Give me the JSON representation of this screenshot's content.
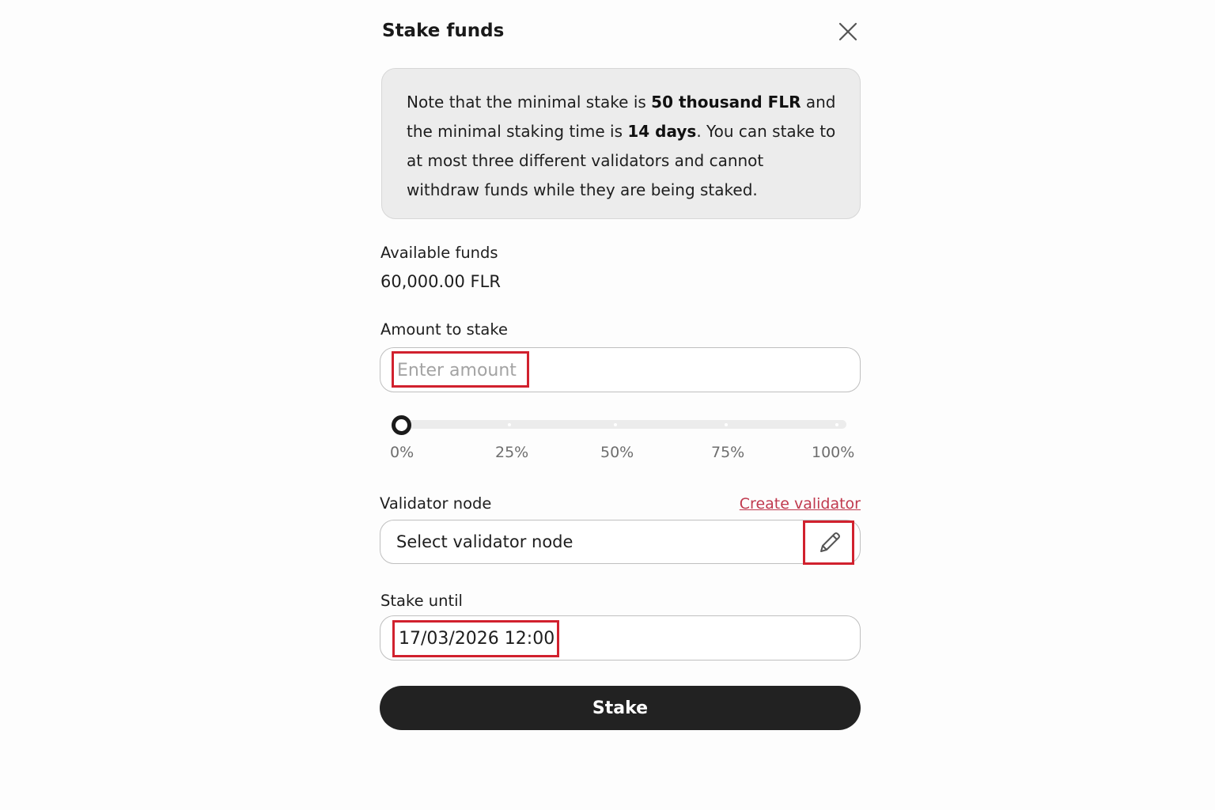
{
  "modal": {
    "title": "Stake funds",
    "close_icon": "close-icon"
  },
  "note": {
    "part1": "Note that the minimal stake is ",
    "bold1": "50 thousand FLR",
    "part2": " and the minimal staking time is ",
    "bold2": "14 days",
    "part3": ". You can stake to at most three different validators and cannot withdraw funds while they are being staked."
  },
  "available_funds": {
    "label": "Available funds",
    "value": "60,000.00 FLR"
  },
  "amount": {
    "label": "Amount to stake",
    "placeholder": "Enter amount",
    "value": ""
  },
  "slider": {
    "value_percent": 0,
    "ticks": [
      "0%",
      "25%",
      "50%",
      "75%",
      "100%"
    ]
  },
  "validator": {
    "label": "Validator node",
    "create_link": "Create validator",
    "select_text": "Select validator node",
    "edit_icon": "pencil-icon"
  },
  "stake_until": {
    "label": "Stake until",
    "value": "17/03/2026 12:00"
  },
  "actions": {
    "stake_label": "Stake"
  },
  "colors": {
    "highlight": "#d1212e",
    "link": "#c0394e",
    "primary_button": "#222222"
  }
}
